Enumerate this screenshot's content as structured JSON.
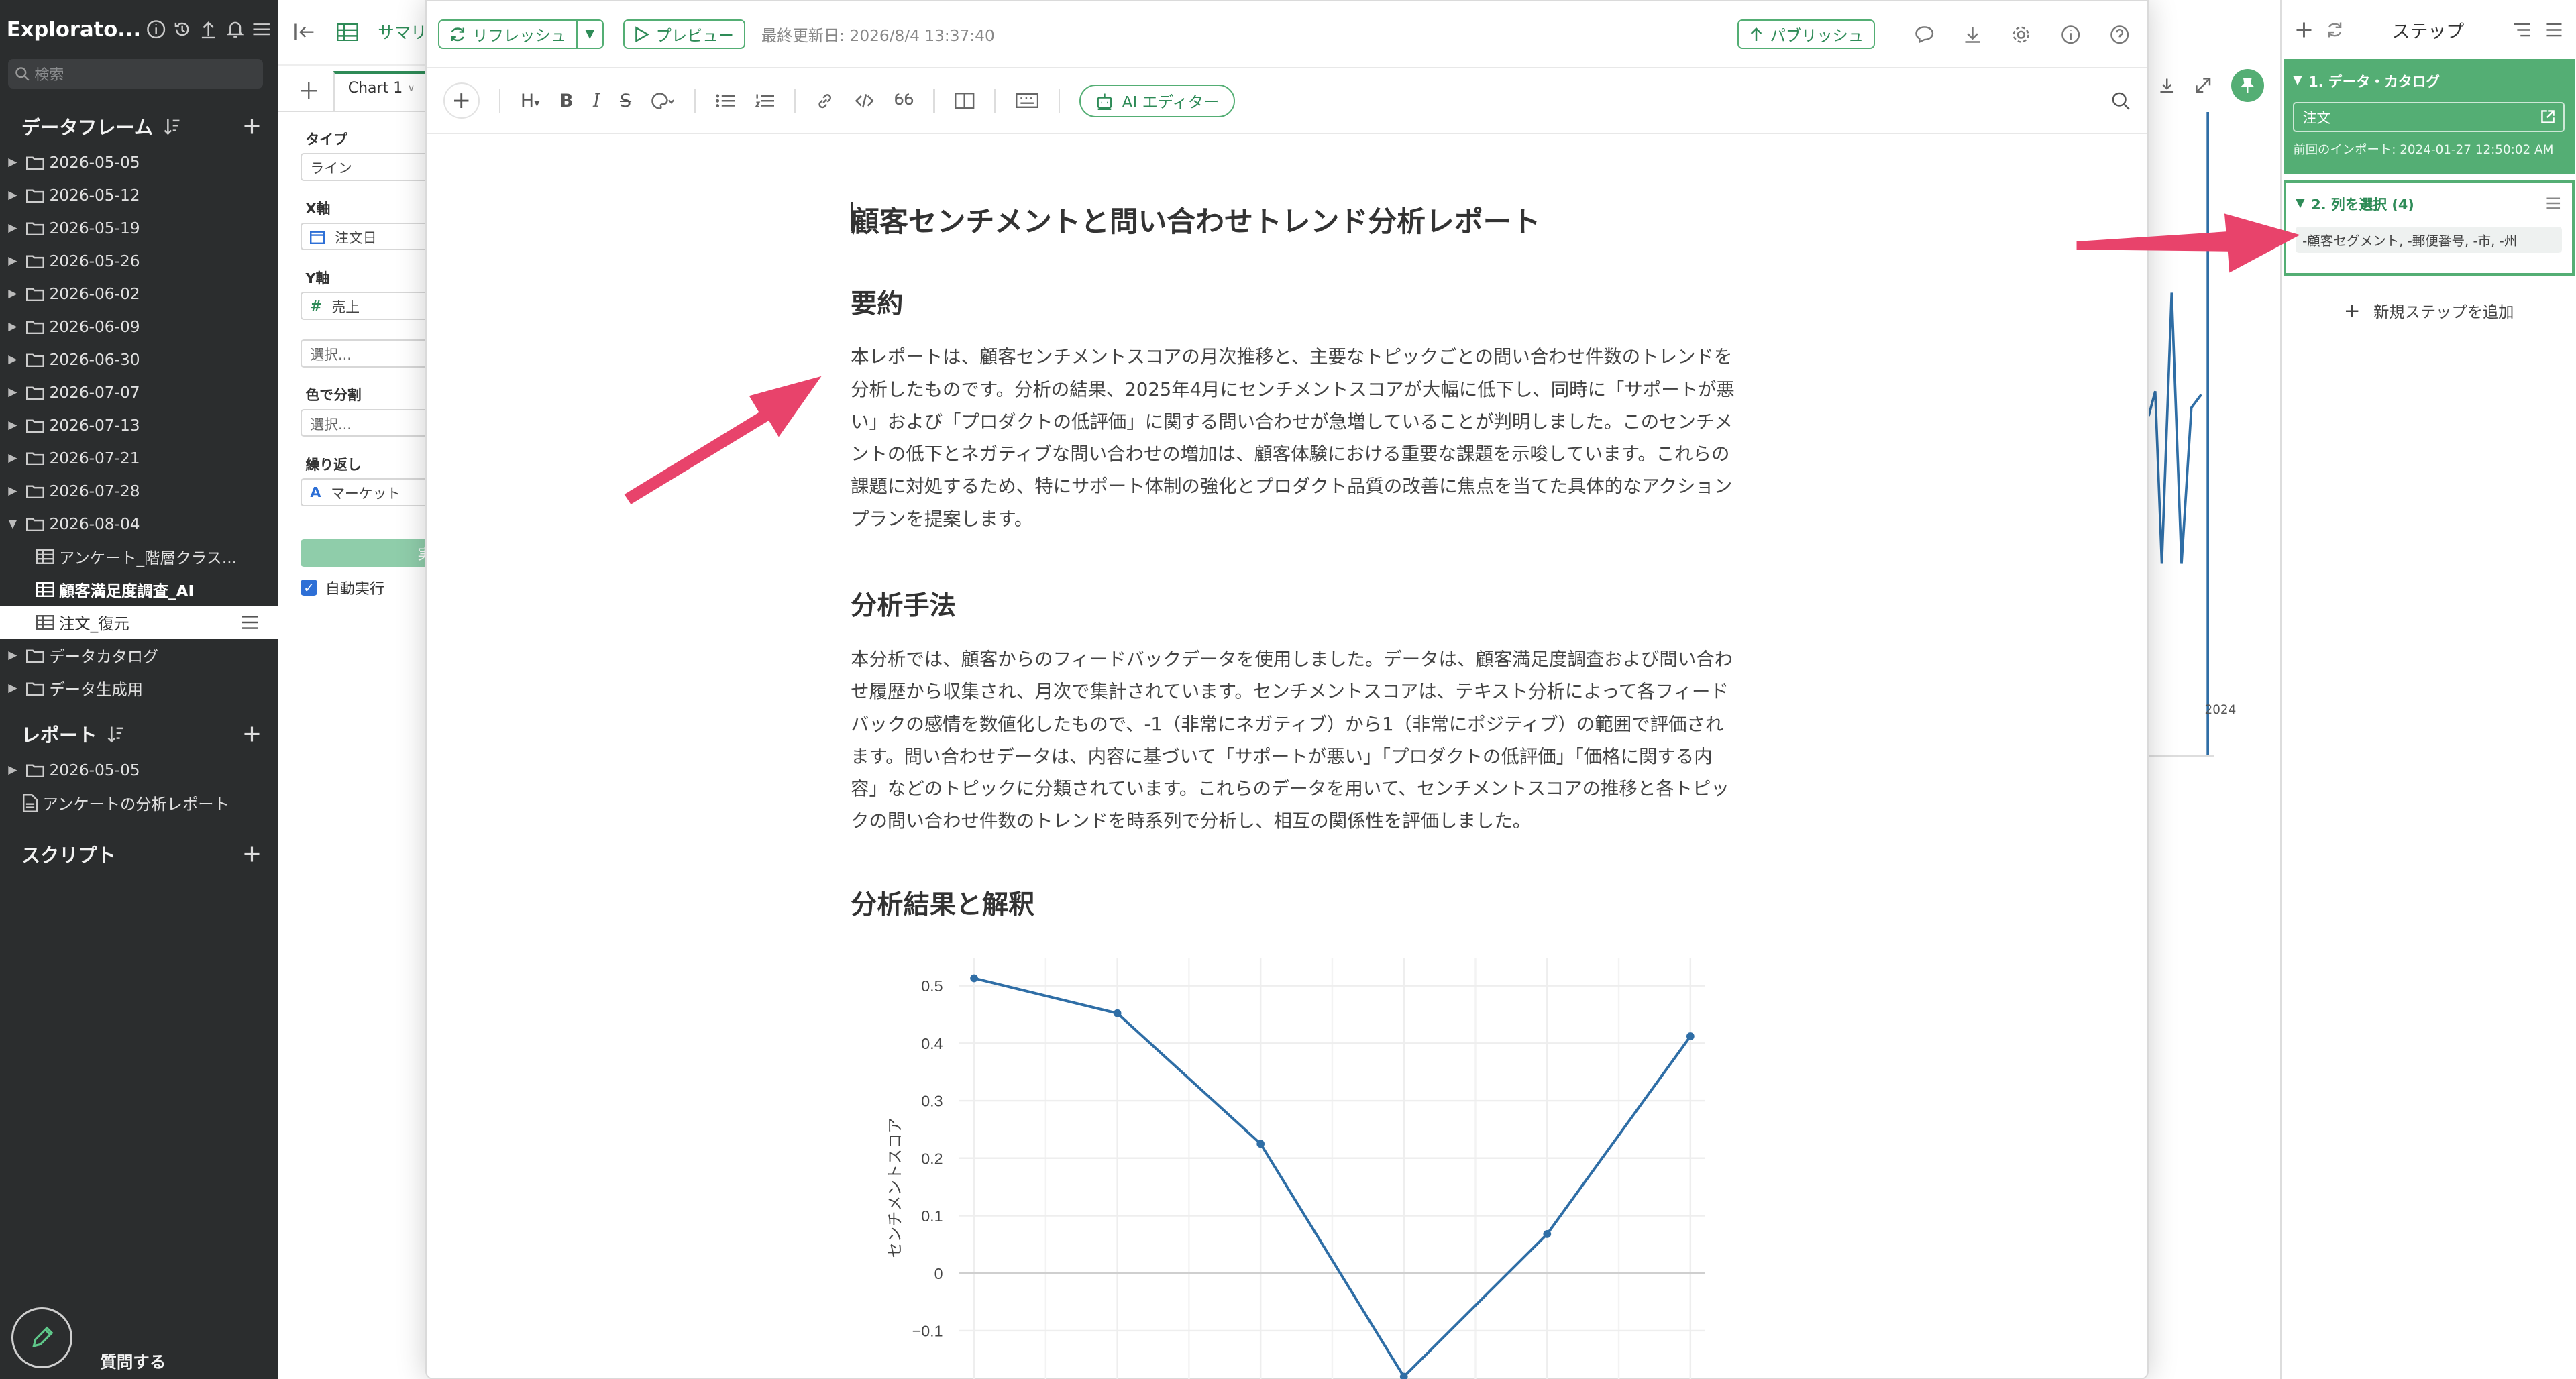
{
  "sidebar": {
    "brand": "Explorato...",
    "search_placeholder": "検索",
    "dataframes_title": "データフレーム",
    "folders": [
      "2026-05-05",
      "2026-05-12",
      "2026-05-19",
      "2026-05-26",
      "2026-06-02",
      "2026-06-09",
      "2026-06-30",
      "2026-07-07",
      "2026-07-13",
      "2026-07-21",
      "2026-07-28",
      "2026-08-04"
    ],
    "children": [
      "アンケート_階層クラス...",
      "顧客満足度調査_AI",
      "注文_復元"
    ],
    "extra_folders": [
      "データカタログ",
      "データ生成用"
    ],
    "reports_title": "レポート",
    "report_items": [
      "2026-05-05",
      "アンケートの分析レポート"
    ],
    "scripts_title": "スクリプト",
    "ask_label": "質問する"
  },
  "chart_config": {
    "tab_partial": "サマリ",
    "chart_tab": "Chart 1",
    "type_label": "タイプ",
    "type_value": "ライン",
    "x_label": "X軸",
    "x_value": "注文日",
    "y_label": "Y軸",
    "y_value": "売上",
    "select_placeholder": "選択...",
    "color_label": "色で分割",
    "repeat_label": "繰り返し",
    "repeat_value": "マーケット",
    "run_partial": "実行",
    "auto_run": "自動実行"
  },
  "bg_chart": {
    "year_label": "2024"
  },
  "steps": {
    "title": "ステップ",
    "step1_title": "1. データ・カタログ",
    "step1_value": "注文",
    "step1_sub": "前回のインポート: 2024-01-27 12:50:02 AM",
    "step2_title": "2. 列を選択 (4)",
    "step2_value": "-顧客セグメント, -郵便番号, -市, -州",
    "add_step": "新規ステップを追加"
  },
  "editor": {
    "refresh": "リフレッシュ",
    "preview": "プレビュー",
    "last_updated": "最終更新日: 2026/8/4 13:37:40",
    "publish": "パブリッシュ",
    "ai_editor": "AI エディター",
    "heading_btn": "H"
  },
  "document": {
    "title": "顧客センチメントと問い合わせトレンド分析レポート",
    "h_summary": "要約",
    "p_summary": "本レポートは、顧客センチメントスコアの月次推移と、主要なトピックごとの問い合わせ件数のトレンドを分析したものです。分析の結果、2025年4月にセンチメントスコアが大幅に低下し、同時に「サポートが悪い」および「プロダクトの低評価」に関する問い合わせが急増していることが判明しました。このセンチメントの低下とネガティブな問い合わせの増加は、顧客体験における重要な課題を示唆しています。これらの課題に対処するため、特にサポート体制の強化とプロダクト品質の改善に焦点を当てた具体的なアクションプランを提案します。",
    "h_method": "分析手法",
    "p_method": "本分析では、顧客からのフィードバックデータを使用しました。データは、顧客満足度調査および問い合わせ履歴から収集され、月次で集計されています。センチメントスコアは、テキスト分析によって各フィードバックの感情を数値化したもので、-1（非常にネガティブ）から1（非常にポジティブ）の範囲で評価されます。問い合わせデータは、内容に基づいて「サポートが悪い」「プロダクトの低評価」「価格に関する内容」などのトピックに分類されています。これらのデータを用いて、センチメントスコアの推移と各トピックの問い合わせ件数のトレンドを時系列で分析し、相互の関係性を評価しました。",
    "h_results": "分析結果と解釈"
  },
  "chart_data": {
    "type": "line",
    "ylabel": "センチメントスコア",
    "ylim": [
      -0.15,
      0.55
    ],
    "yticks": [
      0.5,
      0.4,
      0.3,
      0.2,
      0.1,
      0,
      -0.1
    ],
    "ytick_labels": [
      "0.5",
      "0.4",
      "0.3",
      "0.2",
      "0.1",
      "0",
      "−0.1"
    ],
    "x": [
      0,
      1,
      2,
      3,
      4,
      5
    ],
    "values": [
      0.513,
      0.452,
      0.225,
      -0.18,
      0.068,
      0.412
    ],
    "color": "#2f6ea6"
  },
  "colors": {
    "accent": "#54ae74",
    "arrow": "#e8436b",
    "sidebar": "#2b2d2e"
  }
}
